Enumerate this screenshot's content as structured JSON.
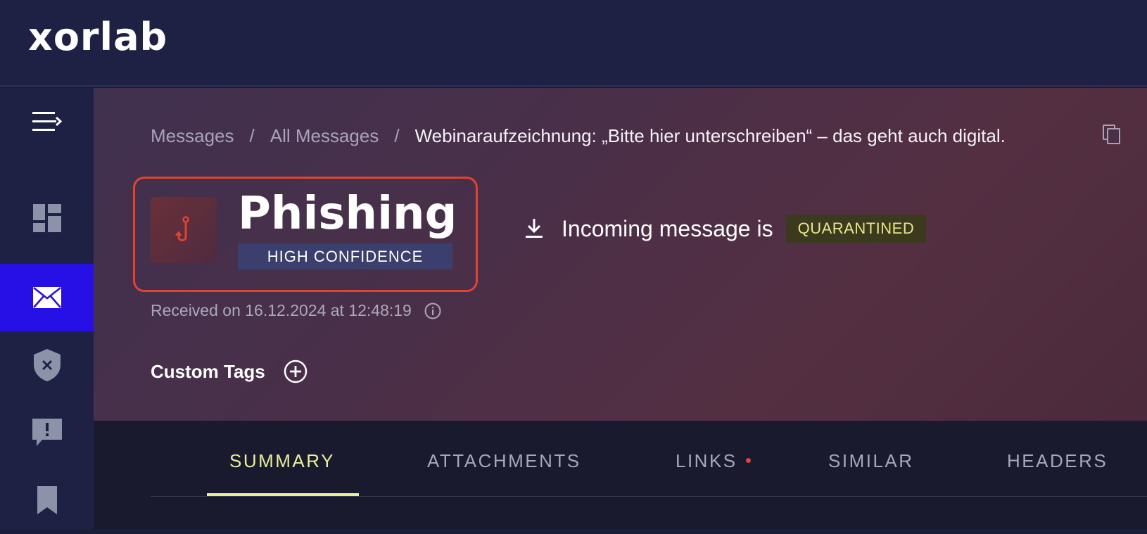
{
  "app": {
    "logo_text": "xorlab"
  },
  "sidebar": {
    "items": [
      {
        "icon": "menu-collapse-icon"
      },
      {
        "icon": "dashboard-icon"
      },
      {
        "icon": "envelope-icon",
        "active": true
      },
      {
        "icon": "shield-x-icon"
      },
      {
        "icon": "alert-message-icon"
      },
      {
        "icon": "bookmark-icon"
      }
    ],
    "active_color": "#2610e6"
  },
  "breadcrumb": {
    "items": [
      "Messages",
      "All Messages"
    ],
    "separator": "/",
    "current": "Webinaraufzeichnung: „Bitte hier unterschreiben“ – das geht auch digital."
  },
  "verdict": {
    "label": "Phishing",
    "confidence": "HIGH CONFIDENCE",
    "icon": "fishhook-icon",
    "accent": "#e0432e"
  },
  "status": {
    "text": "Incoming message is",
    "badge": "QUARANTINED",
    "icon": "download-icon"
  },
  "received": {
    "text": "Received on 16.12.2024 at 12:48:19"
  },
  "custom_tags": {
    "title": "Custom Tags"
  },
  "tabs": [
    {
      "label": "SUMMARY",
      "active": true
    },
    {
      "label": "ATTACHMENTS"
    },
    {
      "label": "LINKS",
      "indicator": true
    },
    {
      "label": "SIMILAR"
    },
    {
      "label": "HEADERS"
    }
  ]
}
